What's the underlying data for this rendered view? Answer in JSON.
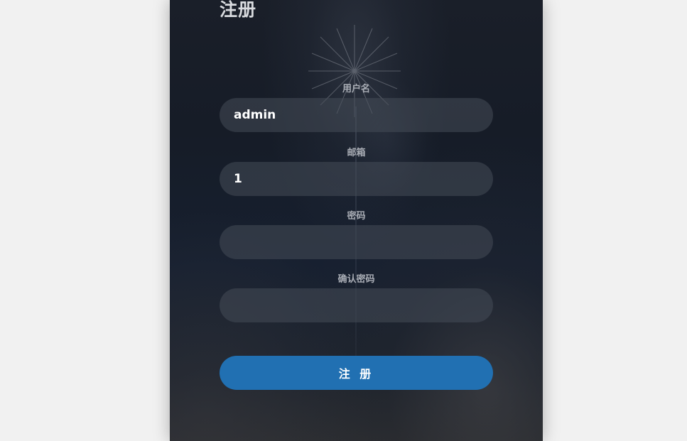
{
  "form": {
    "title": "注册",
    "fields": [
      {
        "label": "用户名",
        "value": "admin",
        "type": "text"
      },
      {
        "label": "邮箱",
        "value": "1",
        "type": "text"
      },
      {
        "label": "密码",
        "value": "",
        "type": "password"
      },
      {
        "label": "确认密码",
        "value": "",
        "type": "password"
      }
    ],
    "submit_label": "注 册"
  },
  "colors": {
    "page_bg": "#f1f1f1",
    "panel_bg": "#171d28",
    "button": "#2170b2"
  }
}
